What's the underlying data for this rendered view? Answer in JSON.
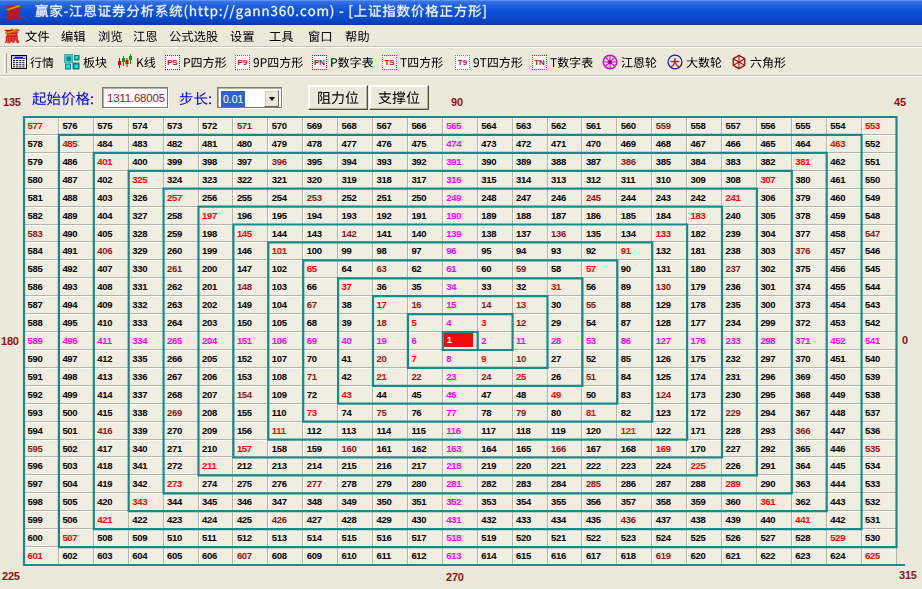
{
  "titlebar": {
    "title": "赢家-江恩证券分析系统(http://gann360.com) - [上证指数价格正方形]",
    "app_icon": "win-brand-icon"
  },
  "menu": {
    "items": [
      "文件",
      "编辑",
      "浏览",
      "江恩",
      "公式选股",
      "设置",
      "工具",
      "窗口",
      "帮助"
    ]
  },
  "toolbar": {
    "items": [
      {
        "icon": "quotes-grid-icon",
        "label": "行情"
      },
      {
        "icon": "blocks-icon",
        "label": "板块"
      },
      {
        "icon": "candlestick-icon",
        "label": "K线"
      },
      {
        "icon": "ps-box-icon",
        "label": "P四方形"
      },
      {
        "icon": "p9-box-icon",
        "label": "9P四方形"
      },
      {
        "icon": "pn-box-icon",
        "label": "P数字表"
      },
      {
        "icon": "ts-box-icon",
        "label": "T四方形"
      },
      {
        "icon": "t9-box-icon",
        "label": "9T四方形"
      },
      {
        "icon": "tn-box-icon",
        "label": "T数字表"
      },
      {
        "icon": "gann-wheel-icon",
        "label": "江恩轮"
      },
      {
        "icon": "big-wheel-icon",
        "label": "大数轮"
      },
      {
        "icon": "hexagon-wheel-icon",
        "label": "六角形"
      }
    ]
  },
  "controls": {
    "start_price_label": "起始价格:",
    "start_price_value": "1311.68005",
    "step_label": "步长:",
    "step_value": "0.01",
    "resistance_button": "阻力位",
    "support_button": "支撑位"
  },
  "angles": {
    "deg0": "0",
    "deg45": "45",
    "deg90": "90",
    "deg135": "135",
    "deg180": "180",
    "deg225": "225",
    "deg270": "270",
    "deg315": "315"
  },
  "grid": {
    "size": 25,
    "center_value": 1,
    "highlighted_value": 1,
    "matrix": [
      [
        577,
        576,
        575,
        574,
        573,
        572,
        571,
        570,
        569,
        568,
        567,
        566,
        565,
        564,
        563,
        562,
        561,
        560,
        559,
        558,
        557,
        556,
        555,
        554,
        553
      ],
      [
        578,
        485,
        484,
        483,
        482,
        481,
        480,
        479,
        478,
        477,
        476,
        475,
        474,
        473,
        472,
        471,
        470,
        469,
        468,
        467,
        466,
        465,
        464,
        463,
        552
      ],
      [
        579,
        486,
        401,
        400,
        399,
        398,
        397,
        396,
        395,
        394,
        393,
        392,
        391,
        390,
        389,
        388,
        387,
        386,
        385,
        384,
        383,
        382,
        381,
        462,
        551
      ],
      [
        580,
        487,
        402,
        325,
        324,
        323,
        322,
        321,
        320,
        319,
        318,
        317,
        316,
        315,
        314,
        313,
        312,
        311,
        310,
        309,
        308,
        307,
        380,
        461,
        550
      ],
      [
        581,
        488,
        403,
        326,
        257,
        256,
        255,
        254,
        253,
        252,
        251,
        250,
        249,
        248,
        247,
        246,
        245,
        244,
        243,
        242,
        241,
        306,
        379,
        460,
        549
      ],
      [
        582,
        489,
        404,
        327,
        258,
        197,
        196,
        195,
        194,
        193,
        192,
        191,
        190,
        189,
        188,
        187,
        186,
        185,
        184,
        183,
        240,
        305,
        378,
        459,
        548
      ],
      [
        583,
        490,
        405,
        328,
        259,
        198,
        145,
        144,
        143,
        142,
        141,
        140,
        139,
        138,
        137,
        136,
        135,
        134,
        133,
        182,
        239,
        304,
        377,
        458,
        547
      ],
      [
        584,
        491,
        406,
        329,
        260,
        199,
        146,
        101,
        100,
        99,
        98,
        97,
        96,
        95,
        94,
        93,
        92,
        91,
        132,
        181,
        238,
        303,
        376,
        457,
        546
      ],
      [
        585,
        492,
        407,
        330,
        261,
        200,
        147,
        102,
        65,
        64,
        63,
        62,
        61,
        60,
        59,
        58,
        57,
        90,
        131,
        180,
        237,
        302,
        375,
        456,
        545
      ],
      [
        586,
        493,
        408,
        331,
        262,
        201,
        148,
        103,
        66,
        37,
        36,
        35,
        34,
        33,
        32,
        31,
        56,
        89,
        130,
        179,
        236,
        301,
        374,
        455,
        544
      ],
      [
        587,
        494,
        409,
        332,
        263,
        202,
        149,
        104,
        67,
        38,
        17,
        16,
        15,
        14,
        13,
        30,
        55,
        88,
        129,
        178,
        235,
        300,
        373,
        454,
        543
      ],
      [
        588,
        495,
        410,
        333,
        264,
        203,
        150,
        105,
        68,
        39,
        18,
        5,
        4,
        3,
        12,
        29,
        54,
        87,
        128,
        177,
        234,
        299,
        372,
        453,
        542
      ],
      [
        589,
        496,
        411,
        334,
        265,
        204,
        151,
        106,
        69,
        40,
        19,
        6,
        1,
        2,
        11,
        28,
        53,
        86,
        127,
        176,
        233,
        298,
        371,
        452,
        541
      ],
      [
        590,
        497,
        412,
        335,
        266,
        205,
        152,
        107,
        70,
        41,
        20,
        7,
        8,
        9,
        10,
        27,
        52,
        85,
        126,
        175,
        232,
        297,
        370,
        451,
        540
      ],
      [
        591,
        498,
        413,
        336,
        267,
        206,
        153,
        108,
        71,
        42,
        21,
        22,
        23,
        24,
        25,
        26,
        51,
        84,
        125,
        174,
        231,
        296,
        369,
        450,
        539
      ],
      [
        592,
        499,
        414,
        337,
        268,
        207,
        154,
        109,
        72,
        43,
        44,
        45,
        46,
        47,
        48,
        49,
        50,
        83,
        124,
        173,
        230,
        295,
        368,
        449,
        538
      ],
      [
        593,
        500,
        415,
        338,
        269,
        208,
        155,
        110,
        73,
        74,
        75,
        76,
        77,
        78,
        79,
        80,
        81,
        82,
        123,
        172,
        229,
        294,
        367,
        448,
        537
      ],
      [
        594,
        501,
        416,
        339,
        270,
        209,
        156,
        111,
        112,
        113,
        114,
        115,
        116,
        117,
        118,
        119,
        120,
        121,
        122,
        171,
        228,
        293,
        366,
        447,
        536
      ],
      [
        595,
        502,
        417,
        340,
        271,
        210,
        157,
        158,
        159,
        160,
        161,
        162,
        163,
        164,
        165,
        166,
        167,
        168,
        169,
        170,
        227,
        292,
        365,
        446,
        535
      ],
      [
        596,
        503,
        418,
        341,
        272,
        211,
        212,
        213,
        214,
        215,
        216,
        217,
        218,
        219,
        220,
        221,
        222,
        223,
        224,
        225,
        226,
        291,
        364,
        445,
        534
      ],
      [
        597,
        504,
        419,
        342,
        273,
        274,
        275,
        276,
        277,
        278,
        279,
        280,
        281,
        282,
        283,
        284,
        285,
        286,
        287,
        288,
        289,
        290,
        363,
        444,
        533
      ],
      [
        598,
        505,
        420,
        343,
        344,
        345,
        346,
        347,
        348,
        349,
        350,
        351,
        352,
        353,
        354,
        355,
        356,
        357,
        358,
        359,
        360,
        361,
        362,
        443,
        532
      ],
      [
        599,
        506,
        421,
        422,
        423,
        424,
        425,
        426,
        427,
        428,
        429,
        430,
        431,
        432,
        433,
        434,
        435,
        436,
        437,
        438,
        439,
        440,
        441,
        442,
        531
      ],
      [
        600,
        507,
        508,
        509,
        510,
        511,
        512,
        513,
        514,
        515,
        516,
        517,
        518,
        519,
        520,
        521,
        522,
        523,
        524,
        525,
        526,
        527,
        528,
        529,
        530
      ],
      [
        601,
        602,
        603,
        604,
        605,
        606,
        607,
        608,
        609,
        610,
        611,
        612,
        613,
        614,
        615,
        616,
        617,
        618,
        619,
        620,
        621,
        622,
        623,
        624,
        625
      ]
    ]
  },
  "colors": {
    "titlebar_blue": "#0d4ecf",
    "window_bg": "#ece9da",
    "cell_bg": "#f0ede1",
    "ring_teal": "#178b8b",
    "cardinal_magenta": "#ff00ff",
    "diagonal_red": "#ff0000",
    "gann2x1_maroon": "#8b1717",
    "label_maroon": "#8b1414",
    "highlight_red": "#ee0d0d",
    "control_label_blue": "#0000f0",
    "price_text_dark_red": "#9a1616",
    "selection_blue": "#2f63c8"
  }
}
